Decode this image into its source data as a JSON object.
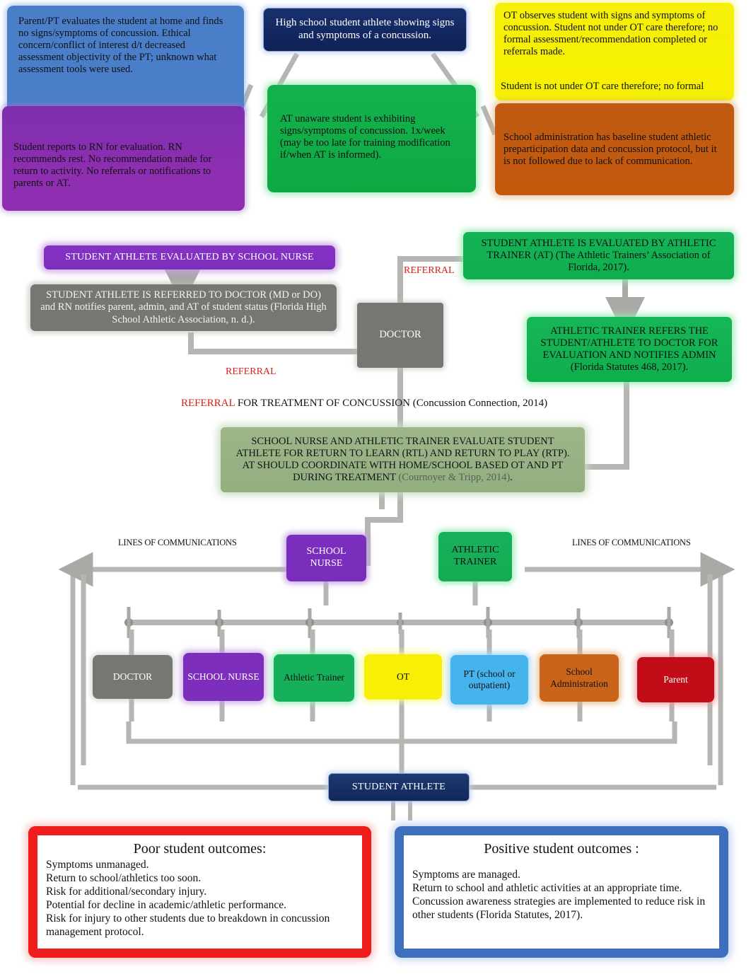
{
  "top": {
    "parent_pt": "Parent/PT evaluates the student at home and finds no signs/symptoms of concussion. Ethical concern/conflict of interest d/t decreased assessment objectivity of the PT; unknown what assessment tools were used.",
    "rn_report": "Student reports to RN for evaluation. RN recommends rest. No recommendation made for return to activity. No referrals or notifications to parents or AT.",
    "hs_athlete": "High school student athlete showing signs and symptoms of a concussion.",
    "at_unaware": "AT unaware student is exhibiting signs/symptoms of concussion. 1x/week (may be too late for training modification if/when AT is informed).",
    "ot_observes": "OT observes student with signs and symptoms of concussion. Student not under OT care therefore; no formal assessment/recommendation completed or referrals made.",
    "ot_note": "Student is not under OT care therefore; no formal",
    "school_admin": "School administration has baseline student athletic preparticipation data and concussion protocol, but it is not followed due to lack of  communication."
  },
  "mid": {
    "eval_by_nurse": "STUDENT ATHLETE EVALUATED BY    SCHOOL  NURSE",
    "referred_to_doctor": "STUDENT ATHLETE IS REFERRED TO DOCTOR (MD or DO) and RN notifies parent, admin, and AT of student status (Florida High School Athletic Association, n. d.).",
    "doctor": "DOCTOR",
    "eval_by_at": "STUDENT ATHLETE IS EVALUATED BY ATHLETIC TRAINER (AT) (The Athletic Trainers’ Association of Florida, 2017).",
    "at_refers": "ATHLETIC TRAINER REFERS THE STUDENT/ATHLETE TO DOCTOR FOR EVALUATION AND NOTIFIES ADMIN (Florida Statutes 468, 2017).",
    "rtl_rtp_main": "SCHOOL NURSE AND ATHLETIC TRAINER EVALUATE STUDENT    ATHLETE FOR RETURN TO LEARN (RTL) AND RETURN TO PLAY (RTP).   AT SHOULD COORDINATE WITH HOME/SCHOOL BASED OT AND PT DURING TREATMENT ",
    "rtl_rtp_cite": "(Cournoyer & Tripp, 2014)",
    "rtl_rtp_tail": ".",
    "referral_label_1": "REFERRAL",
    "referral_label_2": "REFERRAL",
    "referral_treatment_red": "REFERRAL",
    "referral_treatment_rest": " FOR TREATMENT OF CONCUSSION     (Concussion Connection, 2014)"
  },
  "comm": {
    "lines_left": "LINES OF COMMUNICATIONS",
    "lines_right": "LINES OF COMMUNICATIONS",
    "school_nurse": "SCHOOL NURSE",
    "athletic_trainer": "ATHLETIC TRAINER",
    "student_athlete": "STUDENT ATHLETE",
    "roles": [
      {
        "label": "DOCTOR",
        "color": "#767672"
      },
      {
        "label": "SCHOOL NURSE",
        "color": "#7d2ebd"
      },
      {
        "label": "Athletic Trainer",
        "color": "#16b05b"
      },
      {
        "label": "OT",
        "color": "#f7ef06"
      },
      {
        "label": "PT (school  or outpatient)",
        "color": "#46b4ec"
      },
      {
        "label": "School Administration",
        "color": "#c9641a"
      },
      {
        "label": "Parent",
        "color": "#c20d19"
      }
    ]
  },
  "outcomes": {
    "poor": {
      "title": "Poor student outcomes:",
      "lines": [
        "Symptoms unmanaged.",
        "Return to school/athletics too soon.",
        "Risk for additional/secondary injury.",
        "Potential for decline in academic/athletic performance.",
        "Risk for injury to other students due to breakdown in concussion management protocol."
      ],
      "border_color": "#ef1c1c"
    },
    "positive": {
      "title": "Positive student outcomes  :",
      "lines": [
        "Symptoms are managed.",
        "Return to school and athletic activities at an appropriate time.",
        "Concussion awareness strategies are implemented to reduce risk in other students (Florida Statutes, 2017)."
      ],
      "border_color": "#3e6fbe"
    }
  }
}
